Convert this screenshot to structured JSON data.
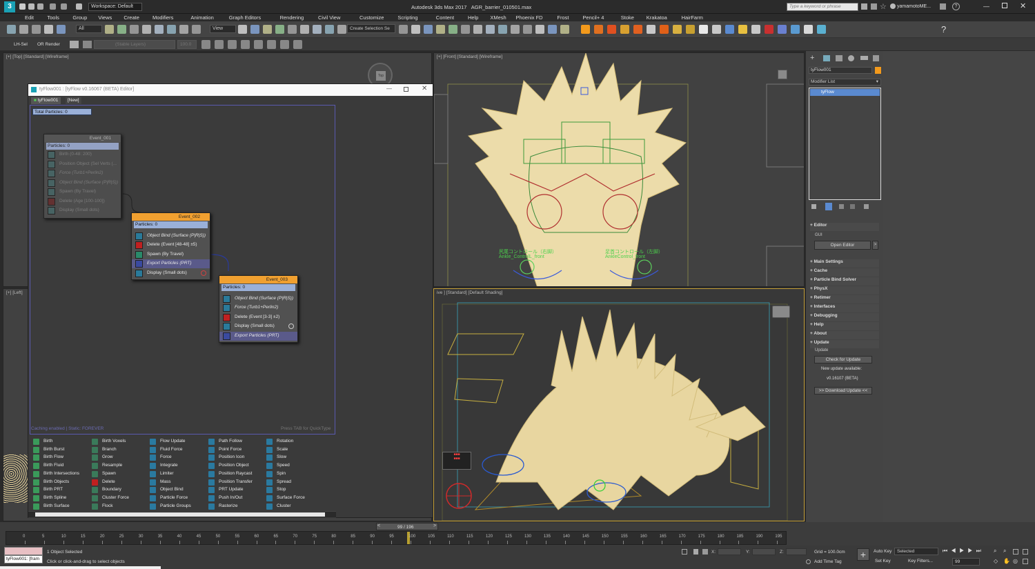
{
  "title_bar": {
    "workspace": "Workspace: Default",
    "app_title": "Autodesk 3ds Max 2017",
    "file_name": "AGR_barrier_010501.max",
    "search_placeholder": "Type a keyword or phrase",
    "user": "yamamotoME..."
  },
  "menu": [
    "Edit",
    "Tools",
    "Group",
    "Views",
    "Create",
    "Modifiers",
    "Animation",
    "Graph Editors",
    "Rendering",
    "Civil View",
    "Customize",
    "Scripting",
    "Content",
    "Help",
    "XMesh",
    "Phoenix FD",
    "Frost",
    "Pencil+ 4",
    "Stoke",
    "Krakatoa",
    "HairFarm"
  ],
  "toolbar": {
    "filter_all": "All",
    "view_dropdown": "View",
    "selection_set": "Create Selection Se"
  },
  "toolbar2": {
    "lh_sel": "LH-Sel",
    "or_render": "OR Render",
    "layer_dropdown": "(Stable Layers)",
    "value": "100.0"
  },
  "viewports": {
    "top": "[+] [Top] [Standard] [Wireframe]",
    "front": "[+] [Front] [Standard] [Wireframe]",
    "left": "[+] [Left]",
    "persp": "ive ] [Standard] [Default Shading]",
    "front_ann1": "尻尾コントロール（右脚）",
    "front_ann2": "Ankle_ControlL_front",
    "front_ann3": "足首コントロール（左脚）",
    "front_ann4": "AnkleControl_front"
  },
  "tyflow_editor": {
    "window_title": "tyFlow001 : [tyFlow v0.16067 (BETA) Editor]",
    "tab1": "tyFlow001",
    "tab2": "[New]",
    "total_particles": "Total Particles: 0",
    "footer_left": "Caching enabled | Static: FOREVER",
    "footer_right": "Press TAB for QuickType",
    "events": [
      {
        "name": "Event_001",
        "particles": "Particles: 0",
        "ops": [
          "Birth (0-48: 200)",
          "Position Object (Sel Verts (...",
          "Force (Turb1+Perlin2)",
          "Object Bind (Surface (P|R|S))",
          "Spawn (By Travel)",
          "Delete (Age [100-100])",
          "Display (Small dots)"
        ]
      },
      {
        "name": "Event_002",
        "particles": "Particles: 0",
        "ops": [
          "Object Bind (Surface (P|R|S))",
          "Delete (Event [48-48] ±5)",
          "Spawn (By Travel)",
          "Export Particles (PRT)",
          "Display (Small dots)"
        ]
      },
      {
        "name": "Event_003",
        "particles": "Particles: 0",
        "ops": [
          "Object Bind (Surface (P|R|S))",
          "Force (Turb1+Perlin2)",
          "Delete (Event [3-3] ±2)",
          "Display (Small dots)",
          "Export Particles (PRT)"
        ]
      }
    ],
    "library": [
      [
        "Birth",
        "Birth Burst",
        "Birth Flow",
        "Birth Fluid",
        "Birth Intersections",
        "Birth Objects",
        "Birth PRT",
        "Birth Spline",
        "Birth Surface"
      ],
      [
        "Birth Voxels",
        "Branch",
        "Grow",
        "Resample",
        "Spawn",
        "Delete",
        "Boundary",
        "Cluster Force",
        "Flock"
      ],
      [
        "Flow Update",
        "Fluid Force",
        "Force",
        "Integrate",
        "Limiter",
        "Mass",
        "Object Bind",
        "Particle Force",
        "Particle Groups"
      ],
      [
        "Path Follow",
        "Point Force",
        "Position Icon",
        "Position Object",
        "Position Raycast",
        "Position Transfer",
        "PRT Update",
        "Push In/Out",
        "Rasterize"
      ],
      [
        "Rotation",
        "Scale",
        "Slow",
        "Speed",
        "Spin",
        "Spread",
        "Stop",
        "Surface Force",
        "Cluster"
      ]
    ]
  },
  "command_panel": {
    "object_name": "tyFlow001",
    "modifier_list": "Modifier List",
    "stack_item": "tyFlow",
    "rollouts": [
      "Editor",
      "Main Settings",
      "Cache",
      "Particle Bind Solver",
      "PhysX",
      "Retimer",
      "Interfaces",
      "Debugging",
      "Help",
      "About",
      "Update"
    ],
    "gui_label": "GUI",
    "open_editor": "Open Editor",
    "update_label": "Update",
    "check_update": "Check for Update",
    "new_update": "New update available:",
    "version": "v0.16107 (BETA)",
    "download": ">> Download Update <<"
  },
  "timeline": {
    "frame": "99 / 196",
    "ticks": [
      "0",
      "5",
      "10",
      "15",
      "20",
      "25",
      "30",
      "35",
      "40",
      "45",
      "50",
      "55",
      "60",
      "65",
      "70",
      "75",
      "80",
      "85",
      "90",
      "95",
      "100",
      "105",
      "110",
      "115",
      "120",
      "125",
      "130",
      "135",
      "140",
      "145",
      "150",
      "155",
      "160",
      "165",
      "170",
      "175",
      "180",
      "185",
      "190",
      "195"
    ]
  },
  "status": {
    "maxscript": "tyFlow001: [fram",
    "selected": "1 Object Selected",
    "prompt": "Click or click-and-drag to select objects",
    "x_label": "X:",
    "y_label": "Y:",
    "z_label": "Z:",
    "grid": "Grid = 100.0cm",
    "add_time_tag": "Add Time Tag",
    "auto_key": "Auto Key",
    "set_key": "Set Key",
    "selected_dropdown": "Selected",
    "key_filters": "Key Filters...",
    "frame_value": "99"
  }
}
